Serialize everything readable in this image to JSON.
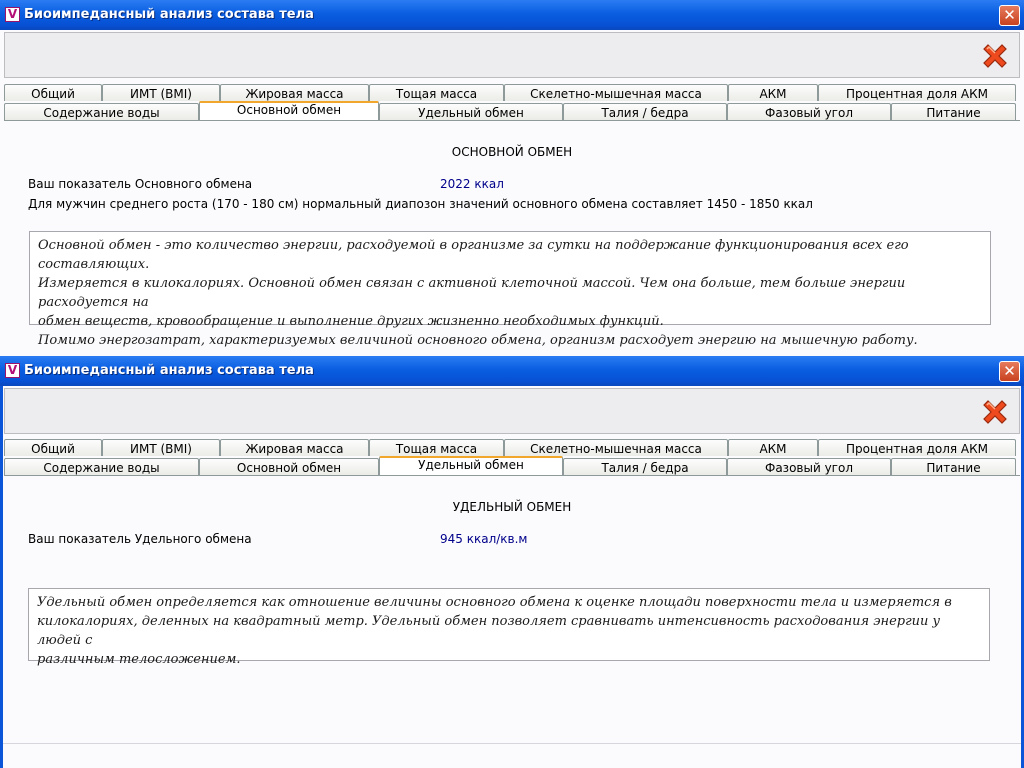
{
  "window_title": "Биоимпедансный анализ состава тела",
  "icons": {
    "app": "app-logo-icon",
    "close": "close-icon",
    "exit": "red-x-exit-icon"
  },
  "app_icon_letter": "V",
  "close_glyph": "✕",
  "tabs_row1": [
    "Общий",
    "ИМТ (BMI)",
    "Жировая масса",
    "Тощая масса",
    "Скелетно-мышечная масса",
    "АКМ",
    "Процентная доля АКМ"
  ],
  "tabs_row2": [
    "Содержание воды",
    "Основной обмен",
    "Удельный обмен",
    "Талия / бедра",
    "Фазовый угол",
    "Питание"
  ],
  "window1": {
    "active_tab": "Основной обмен",
    "heading": "ОСНОВНОЙ ОБМЕН",
    "indicator_label": "Ваш показатель Основного обмена",
    "indicator_value": "2022  ккал",
    "norm_text": "Для мужчин среднего роста (170 - 180 см) нормальный диапозон значений основного обмена составляет 1450 - 1850 ккал",
    "description": [
      "Основной обмен - это количество энергии, расходуемой в организме за сутки на поддержание функционирования всех его составляющих.",
      "Измеряется в килокалориях. Основной обмен связан с активной клеточной массой. Чем она больше, тем больше энергии расходуется на",
      "обмен веществ, кровообращение и выполнение других жизненно необходимых функций.",
      "Помимо энергозатрат, характеризуемых величиной основного обмена, организм расходует энергию на мышечную работу."
    ]
  },
  "window2": {
    "active_tab": "Удельный обмен",
    "heading": "УДЕЛЬНЫЙ ОБМЕН",
    "indicator_label": "Ваш показатель Удельного обмена",
    "indicator_value": "945  ккал/кв.м",
    "description": [
      "Удельный обмен определяется как отношение величины основного обмена к оценке площади поверхности тела и измеряется в",
      "килокалориях, деленных на квадратный метр. Удельный обмен позволяет сравнивать интенсивность расходования энергии у людей с",
      "различным телосложением."
    ]
  },
  "colors": {
    "titlebar": "#0a5ee0",
    "value_text": "#00008b",
    "active_tab_accent": "#f0a72c",
    "exit_icon": "#e8401c"
  }
}
